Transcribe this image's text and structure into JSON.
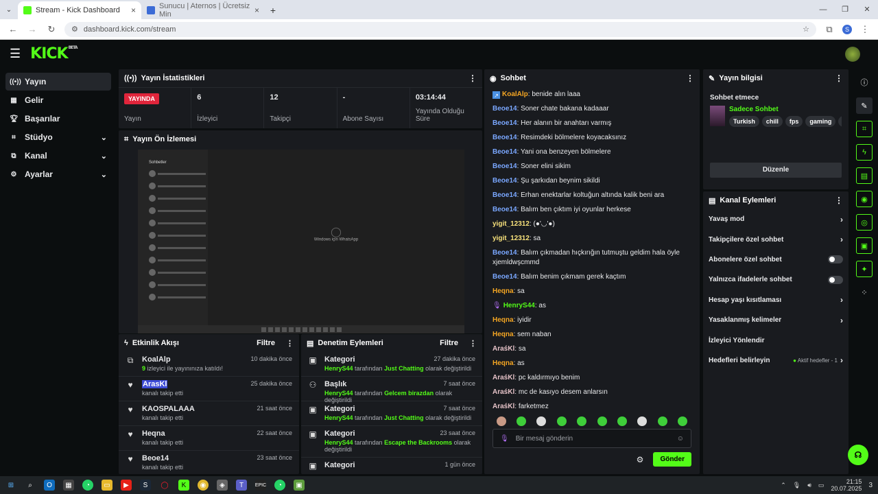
{
  "browser": {
    "tabs": [
      {
        "title": "Stream - Kick Dashboard",
        "active": true
      },
      {
        "title": "Sunucu | Aternos | Ücretsiz Min",
        "active": false
      }
    ],
    "url": "dashboard.kick.com/stream",
    "profile": "S"
  },
  "app": {
    "logo": "KICK",
    "beta": "BETA"
  },
  "sidebar": {
    "items": [
      {
        "label": "Yayın",
        "icon": "broadcast-icon",
        "active": true,
        "chevron": false
      },
      {
        "label": "Gelir",
        "icon": "revenue-icon",
        "chevron": false
      },
      {
        "label": "Başarılar",
        "icon": "trophy-icon",
        "chevron": false
      },
      {
        "label": "Stüdyo",
        "icon": "studio-icon",
        "chevron": true
      },
      {
        "label": "Kanal",
        "icon": "channel-icon",
        "chevron": true
      },
      {
        "label": "Ayarlar",
        "icon": "gear-icon",
        "chevron": true
      }
    ]
  },
  "stats": {
    "title": "Yayın İstatistikleri",
    "items": [
      {
        "value": "YAYINDA",
        "label": "Yayın",
        "badge": true
      },
      {
        "value": "6",
        "label": "İzleyici"
      },
      {
        "value": "12",
        "label": "Takipçi"
      },
      {
        "value": "-",
        "label": "Abone Sayısı"
      },
      {
        "value": "03:14:44",
        "label": "Yayında Olduğu Süre"
      }
    ]
  },
  "preview": {
    "title": "Yayın Ön İzlemesi",
    "wa_title": "Sohbetler",
    "wa_center": "Windows için WhatsApp"
  },
  "activity": {
    "title": "Etkinlik Akışı",
    "filter": "Filtre",
    "items": [
      {
        "name": "KoalAlp",
        "time": "10 dakika önce",
        "sub_num": "9",
        "sub": " izleyici ile yayınınıza katıldı!",
        "icon": "raid-icon",
        "highlight": false
      },
      {
        "name": "ArasKl",
        "time": "25 dakika önce",
        "sub": "kanalı takip etti",
        "icon": "heart-icon",
        "highlight": true
      },
      {
        "name": "KAOSPALAAA",
        "time": "21 saat önce",
        "sub": "kanalı takip etti",
        "icon": "heart-icon"
      },
      {
        "name": "Heqna",
        "time": "22 saat önce",
        "sub": "kanalı takip etti",
        "icon": "heart-icon"
      },
      {
        "name": "Beoe14",
        "time": "23 saat önce",
        "sub": "kanalı takip etti",
        "icon": "heart-icon"
      }
    ]
  },
  "moderation": {
    "title": "Denetim Eylemleri",
    "filter": "Filtre",
    "items": [
      {
        "title": "Kategori",
        "time": "27 dakika önce",
        "user": "HenryS44",
        "mid": " tarafından ",
        "value": "Just Chatting",
        "tail": " olarak değiştirildi"
      },
      {
        "title": "Başlık",
        "time": "7 saat önce",
        "user": "HenryS44",
        "mid": " tarafından ",
        "value": "Gelcem birazdan",
        "tail": " olarak değiştirildi"
      },
      {
        "title": "Kategori",
        "time": "7 saat önce",
        "user": "HenryS44",
        "mid": " tarafından ",
        "value": "Just Chatting",
        "tail": " olarak değiştirildi"
      },
      {
        "title": "Kategori",
        "time": "23 saat önce",
        "user": "HenryS44",
        "mid": " tarafından ",
        "value": "Escape the Backrooms",
        "tail": " olarak değiştirildi"
      },
      {
        "title": "Kategori",
        "time": "1 gün önce",
        "user": "",
        "mid": "",
        "value": "",
        "tail": ""
      }
    ]
  },
  "chat": {
    "title": "Sohbet",
    "placeholder": "Bir mesaj gönderin",
    "send": "Gönder",
    "messages": [
      {
        "user": "KoalAlp",
        "color": "#f5a623",
        "text": "benide alın laaa",
        "badge": true
      },
      {
        "user": "Beoe14",
        "color": "#7aa7ff",
        "text": "Soner chate bakana kadaaar"
      },
      {
        "user": "Beoe14",
        "color": "#7aa7ff",
        "text": "Her alanın bir anahtarı varmış"
      },
      {
        "user": "Beoe14",
        "color": "#7aa7ff",
        "text": "Resimdeki bölmelere koyacaksınız"
      },
      {
        "user": "Beoe14",
        "color": "#7aa7ff",
        "text": "Yani ona benzeyen bölmelere"
      },
      {
        "user": "Beoe14",
        "color": "#7aa7ff",
        "text": "Soner elini sikim"
      },
      {
        "user": "Beoe14",
        "color": "#7aa7ff",
        "text": "Şu şarkıdan beynim sikildi"
      },
      {
        "user": "Beoe14",
        "color": "#7aa7ff",
        "text": "Erhan enektarlar koltuğun altında kalik beni ara"
      },
      {
        "user": "Beoe14",
        "color": "#7aa7ff",
        "text": "Balım ben çıktım iyi oyunlar herkese"
      },
      {
        "user": "yigit_12312",
        "color": "#f7e17b",
        "text": "(●'◡'●)"
      },
      {
        "user": "yigit_12312",
        "color": "#f7e17b",
        "text": "sa"
      },
      {
        "user": "Beoe14",
        "color": "#7aa7ff",
        "text": "Balım çıkmadan hıçkırığın tutmuştu geldim hala öyle xjemldwşcmmd"
      },
      {
        "user": "Beoe14",
        "color": "#7aa7ff",
        "text": "Balım benim çıkmam gerek kaçtım"
      },
      {
        "user": "Heqna",
        "color": "#f5a623",
        "text": "sa"
      },
      {
        "user": "HenryS44",
        "color": "#53fc18",
        "text": "as",
        "mic": true
      },
      {
        "user": "Heqna",
        "color": "#f5a623",
        "text": "iyidir"
      },
      {
        "user": "Heqna",
        "color": "#f5a623",
        "text": "sem naban"
      },
      {
        "user": "AraśKl",
        "color": "#e6c3c8",
        "text": "sa"
      },
      {
        "user": "Heqna",
        "color": "#f5a623",
        "text": "as"
      },
      {
        "user": "AraśKl",
        "color": "#e6c3c8",
        "text": "pc kaldırmıyo benim"
      },
      {
        "user": "AraśKl",
        "color": "#e6c3c8",
        "text": "mc de kasıyo desem anlarsın"
      },
      {
        "user": "AraśKl",
        "color": "#e6c3c8",
        "text": "farketmez"
      }
    ]
  },
  "info": {
    "title": "Yayın bilgisi",
    "status": "Sohbet etmece",
    "category": "Sadece Sohbet",
    "tags": [
      "Turkish",
      "chill",
      "fps",
      "gaming",
      "fu"
    ],
    "edit": "Düzenle"
  },
  "channel_actions": {
    "title": "Kanal Eylemleri",
    "items": [
      {
        "label": "Yavaş mod",
        "type": "chevron"
      },
      {
        "label": "Takipçilere özel sohbet",
        "type": "chevron"
      },
      {
        "label": "Abonelere özel sohbet",
        "type": "toggle"
      },
      {
        "label": "Yalnızca ifadelerle sohbet",
        "type": "toggle"
      },
      {
        "label": "Hesap yaşı kısıtlaması",
        "type": "chevron"
      },
      {
        "label": "Yasaklanmış kelimeler",
        "type": "chevron"
      },
      {
        "label": "İzleyici Yönlendir",
        "type": "none"
      },
      {
        "label": "Hedefleri belirleyin",
        "type": "goal",
        "extra": "Aktif hedefler - 1"
      }
    ]
  },
  "taskbar": {
    "time": "21:15",
    "date": "20.07.2025",
    "notif": "3"
  }
}
